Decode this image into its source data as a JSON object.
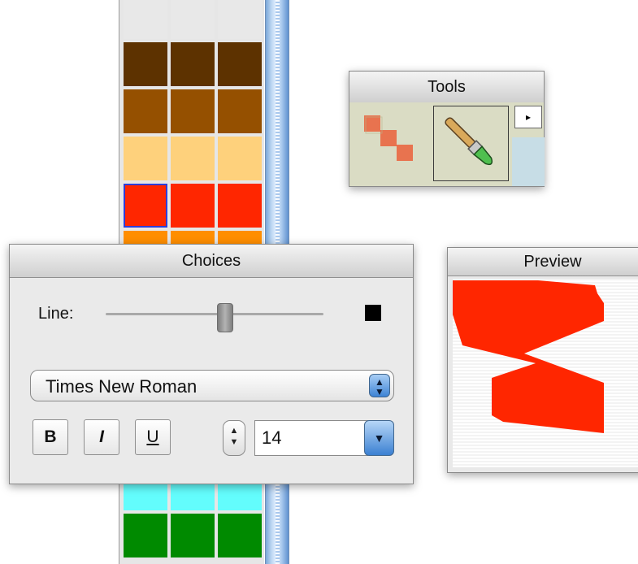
{
  "palette": {
    "rows": [
      {
        "color": "#e8e8e8"
      },
      {
        "color": "#5d3200"
      },
      {
        "color": "#955000"
      },
      {
        "color": "#fed17c"
      },
      {
        "color": "#ff2600",
        "selected_first": true
      },
      {
        "color": "#ff8e00"
      },
      {
        "color": "#63fdfd"
      },
      {
        "color": "#008a00"
      }
    ]
  },
  "tools": {
    "title": "Tools",
    "line_tool_icon": "step-line-icon",
    "brush_tool_icon": "paintbrush-icon",
    "menu_arrow_icon": "triangle-right-icon"
  },
  "choices": {
    "title": "Choices",
    "line_label": "Line:",
    "line_color": "#000000",
    "font": "Times New Roman",
    "bold_label": "B",
    "italic_label": "I",
    "underline_label": "U",
    "size": "14"
  },
  "preview": {
    "title": "Preview",
    "stroke_color": "#ff2600"
  }
}
